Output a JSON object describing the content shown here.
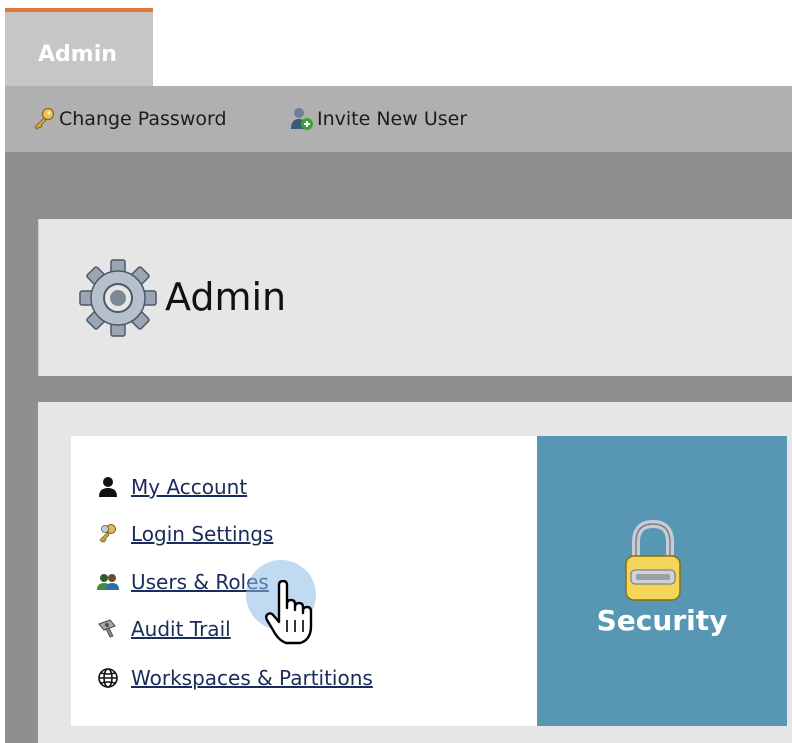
{
  "tabs": [
    {
      "label": "Admin",
      "active": true
    }
  ],
  "toolbar": {
    "change_password": {
      "label": "Change Password",
      "icon": "key-icon"
    },
    "invite_user": {
      "label": "Invite New User",
      "icon": "add-user-icon"
    }
  },
  "header": {
    "title": "Admin",
    "icon": "gear-icon"
  },
  "menu": {
    "items": [
      {
        "label": "My Account",
        "icon": "person-icon"
      },
      {
        "label": "Login Settings",
        "icon": "keys-icon"
      },
      {
        "label": "Users & Roles",
        "icon": "users-icon"
      },
      {
        "label": "Audit Trail",
        "icon": "audit-icon"
      },
      {
        "label": "Workspaces & Partitions",
        "icon": "globe-icon"
      }
    ]
  },
  "security_tile": {
    "label": "Security",
    "icon": "padlock-icon"
  },
  "colors": {
    "tab_accent": "#e0763a",
    "security_tile": "#5797b3",
    "link": "#1a2c5a",
    "toolbar": "#b0b0b0",
    "stage": "#8f8f8f"
  }
}
